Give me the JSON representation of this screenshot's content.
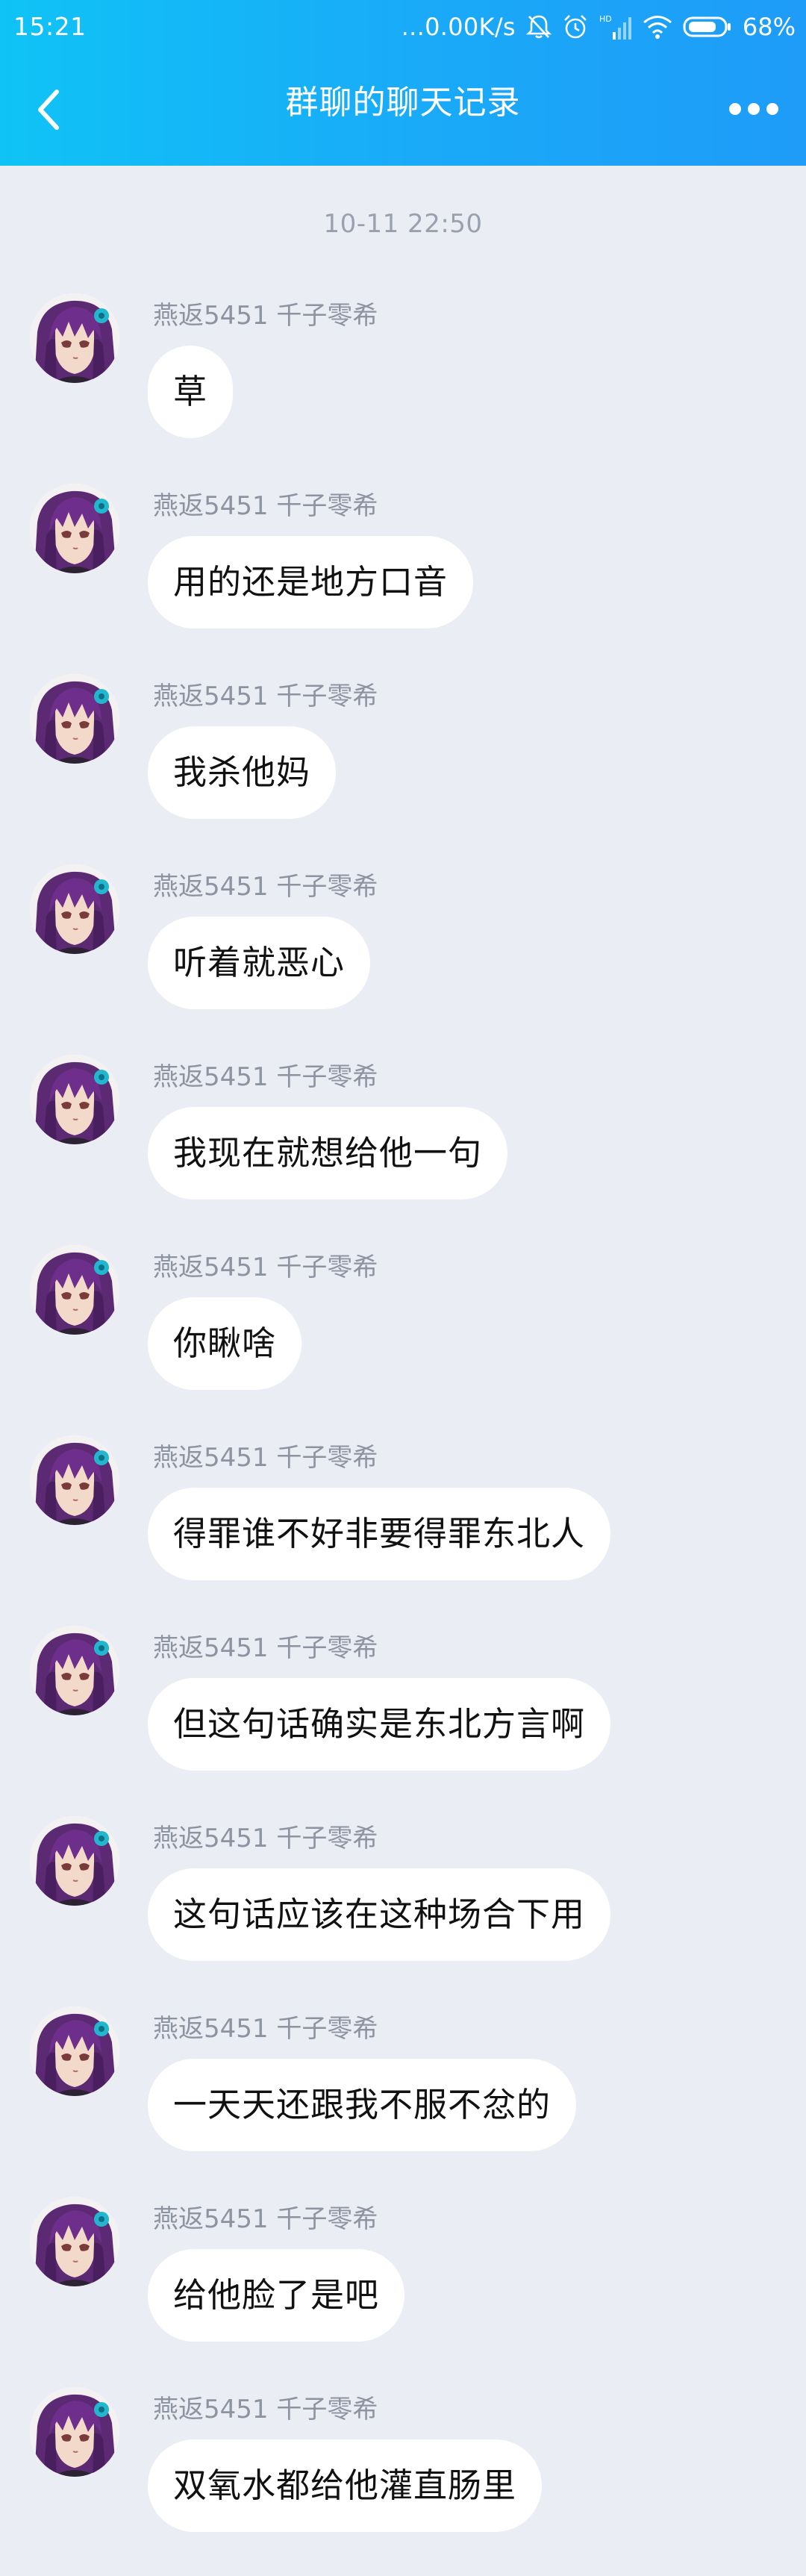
{
  "status_bar": {
    "time": "15:21",
    "network_speed": "...0.00K/s",
    "battery": "68%",
    "hd_label": "HD",
    "icons": [
      "mute-bell-icon",
      "alarm-icon",
      "signal-icon",
      "wifi-icon",
      "battery-icon"
    ]
  },
  "nav": {
    "title": "群聊的聊天记录",
    "back_icon": "back-chevron-icon",
    "more_icon": "more-dots-icon"
  },
  "chat": {
    "timestamp": "10-11 22:50",
    "messages": [
      {
        "sender": "燕返5451 千子零希",
        "text": "草"
      },
      {
        "sender": "燕返5451 千子零希",
        "text": "用的还是地方口音"
      },
      {
        "sender": "燕返5451 千子零希",
        "text": "我杀他妈"
      },
      {
        "sender": "燕返5451 千子零希",
        "text": "听着就恶心"
      },
      {
        "sender": "燕返5451 千子零希",
        "text": "我现在就想给他一句"
      },
      {
        "sender": "燕返5451 千子零希",
        "text": "你瞅啥"
      },
      {
        "sender": "燕返5451 千子零希",
        "text": "得罪谁不好非要得罪东北人"
      },
      {
        "sender": "燕返5451 千子零希",
        "text": "但这句话确实是东北方言啊"
      },
      {
        "sender": "燕返5451 千子零希",
        "text": "这句话应该在这种场合下用"
      },
      {
        "sender": "燕返5451 千子零希",
        "text": "一天天还跟我不服不忿的"
      },
      {
        "sender": "燕返5451 千子零希",
        "text": "给他脸了是吧"
      },
      {
        "sender": "燕返5451 千子零希",
        "text": "双氧水都给他灌直肠里"
      }
    ]
  },
  "colors": {
    "header_start": "#0fc3f6",
    "header_end": "#1e9cf8",
    "background": "#ebedf5",
    "bubble": "#ffffff",
    "sender_text": "#8d93a0",
    "timestamp_text": "#9aa0ad"
  }
}
